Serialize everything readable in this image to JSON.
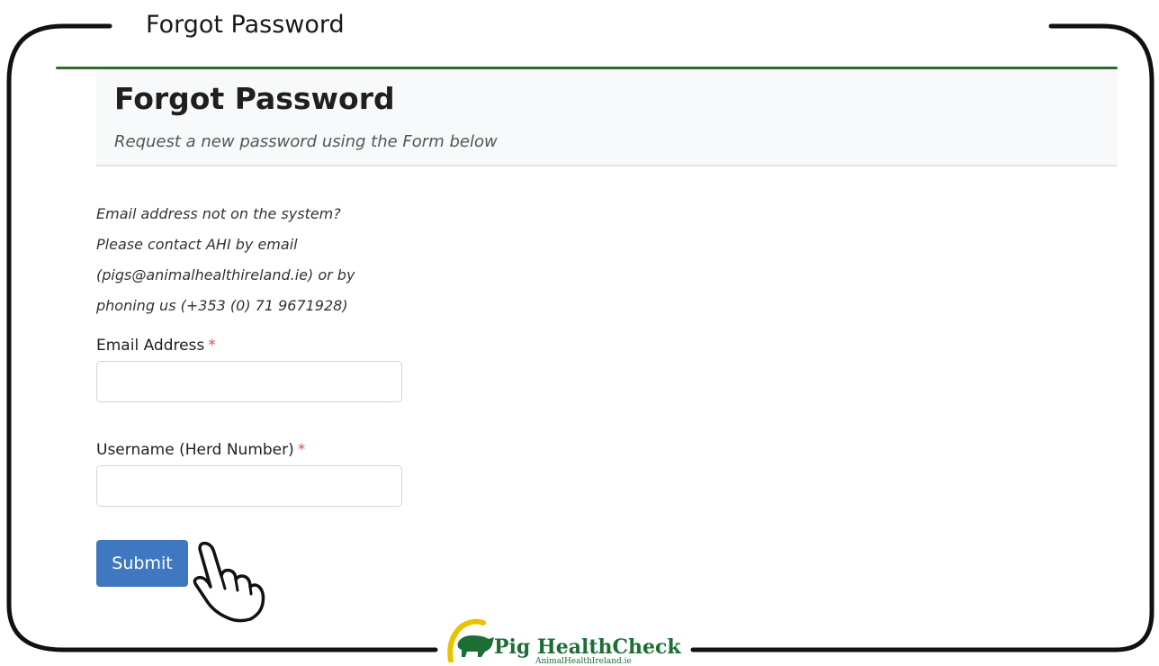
{
  "frame": {
    "title": "Forgot Password"
  },
  "header": {
    "title": "Forgot Password",
    "subtitle": "Request a new password using the Form below"
  },
  "note": {
    "lines": [
      "Email address not on the system?",
      "Please contact AHI by email",
      "(pigs@animalhealthireland.ie) or by",
      "phoning us (+353 (0) 71 9671928)"
    ]
  },
  "form": {
    "email_label": "Email Address",
    "email_value": "",
    "username_label": "Username (Herd Number)",
    "username_value": "",
    "required_marker": "*",
    "submit_label": "Submit"
  },
  "logo": {
    "name": "Pig HealthCheck",
    "site": "AnimalHealthIreland.ie"
  },
  "colors": {
    "accent_green": "#2e6b2e",
    "submit_blue": "#3f78c1",
    "required_red": "#d9534f"
  }
}
